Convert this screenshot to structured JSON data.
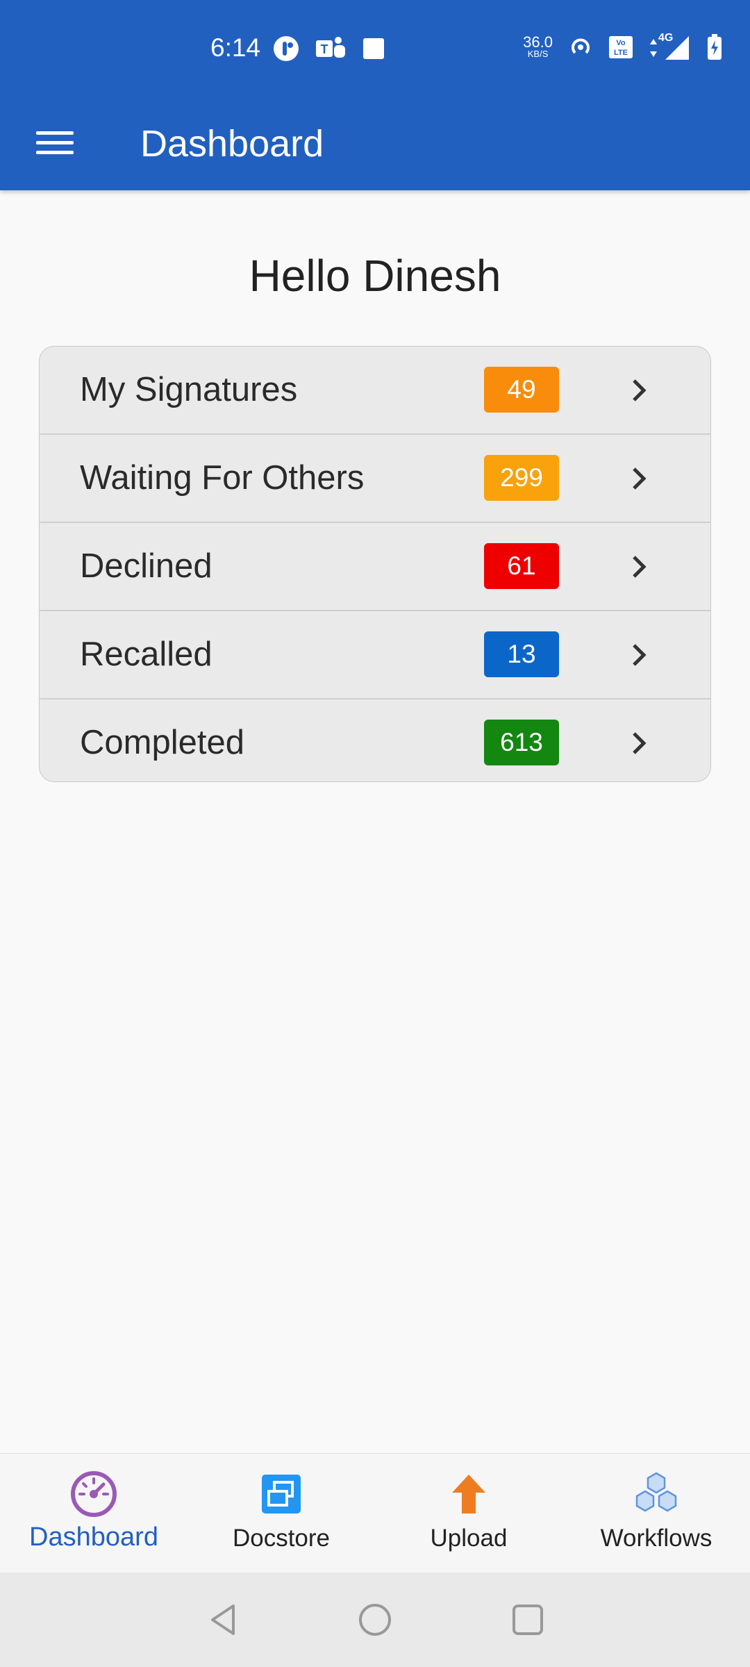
{
  "status_bar": {
    "time": "6:14",
    "net_speed": "36.0",
    "net_unit": "KB/S",
    "network": "4G",
    "left_icons": [
      "notification-app-icon",
      "teams-icon",
      "square-icon"
    ],
    "right_icons": [
      "hotspot-icon",
      "volte-icon",
      "signal-icon",
      "battery-icon"
    ]
  },
  "app_bar": {
    "title": "Dashboard"
  },
  "greeting": "Hello Dinesh",
  "summary": [
    {
      "label": "My Signatures",
      "count": "49",
      "color": "#f98c0a"
    },
    {
      "label": "Waiting For Others",
      "count": "299",
      "color": "#f9a20c"
    },
    {
      "label": "Declined",
      "count": "61",
      "color": "#ef0000"
    },
    {
      "label": "Recalled",
      "count": "13",
      "color": "#0b66c9"
    },
    {
      "label": "Completed",
      "count": "613",
      "color": "#13870f"
    }
  ],
  "bottom_nav": [
    {
      "label": "Dashboard",
      "icon": "speedometer-icon",
      "active": true
    },
    {
      "label": "Docstore",
      "icon": "docstore-icon",
      "active": false
    },
    {
      "label": "Upload",
      "icon": "upload-arrow-icon",
      "active": false
    },
    {
      "label": "Workflows",
      "icon": "cubes-icon",
      "active": false
    }
  ],
  "colors": {
    "primary": "#2260c0",
    "active_icon": "#9b59b6"
  }
}
